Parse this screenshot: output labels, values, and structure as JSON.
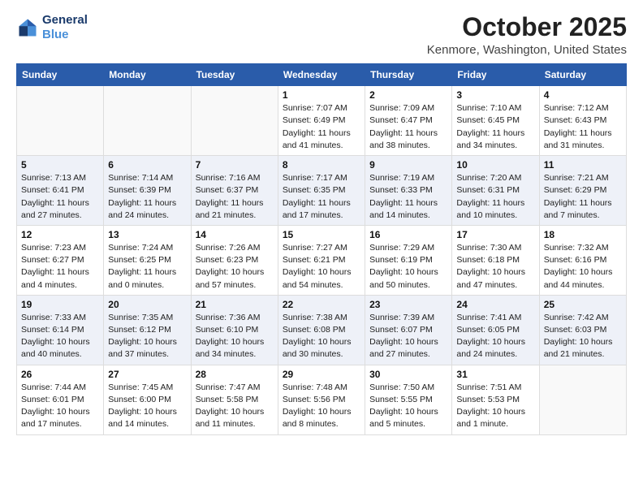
{
  "header": {
    "logo_line1": "General",
    "logo_line2": "Blue",
    "month": "October 2025",
    "location": "Kenmore, Washington, United States"
  },
  "weekdays": [
    "Sunday",
    "Monday",
    "Tuesday",
    "Wednesday",
    "Thursday",
    "Friday",
    "Saturday"
  ],
  "weeks": [
    [
      {
        "day": "",
        "sunrise": "",
        "sunset": "",
        "daylight": ""
      },
      {
        "day": "",
        "sunrise": "",
        "sunset": "",
        "daylight": ""
      },
      {
        "day": "",
        "sunrise": "",
        "sunset": "",
        "daylight": ""
      },
      {
        "day": "1",
        "sunrise": "Sunrise: 7:07 AM",
        "sunset": "Sunset: 6:49 PM",
        "daylight": "Daylight: 11 hours and 41 minutes."
      },
      {
        "day": "2",
        "sunrise": "Sunrise: 7:09 AM",
        "sunset": "Sunset: 6:47 PM",
        "daylight": "Daylight: 11 hours and 38 minutes."
      },
      {
        "day": "3",
        "sunrise": "Sunrise: 7:10 AM",
        "sunset": "Sunset: 6:45 PM",
        "daylight": "Daylight: 11 hours and 34 minutes."
      },
      {
        "day": "4",
        "sunrise": "Sunrise: 7:12 AM",
        "sunset": "Sunset: 6:43 PM",
        "daylight": "Daylight: 11 hours and 31 minutes."
      }
    ],
    [
      {
        "day": "5",
        "sunrise": "Sunrise: 7:13 AM",
        "sunset": "Sunset: 6:41 PM",
        "daylight": "Daylight: 11 hours and 27 minutes."
      },
      {
        "day": "6",
        "sunrise": "Sunrise: 7:14 AM",
        "sunset": "Sunset: 6:39 PM",
        "daylight": "Daylight: 11 hours and 24 minutes."
      },
      {
        "day": "7",
        "sunrise": "Sunrise: 7:16 AM",
        "sunset": "Sunset: 6:37 PM",
        "daylight": "Daylight: 11 hours and 21 minutes."
      },
      {
        "day": "8",
        "sunrise": "Sunrise: 7:17 AM",
        "sunset": "Sunset: 6:35 PM",
        "daylight": "Daylight: 11 hours and 17 minutes."
      },
      {
        "day": "9",
        "sunrise": "Sunrise: 7:19 AM",
        "sunset": "Sunset: 6:33 PM",
        "daylight": "Daylight: 11 hours and 14 minutes."
      },
      {
        "day": "10",
        "sunrise": "Sunrise: 7:20 AM",
        "sunset": "Sunset: 6:31 PM",
        "daylight": "Daylight: 11 hours and 10 minutes."
      },
      {
        "day": "11",
        "sunrise": "Sunrise: 7:21 AM",
        "sunset": "Sunset: 6:29 PM",
        "daylight": "Daylight: 11 hours and 7 minutes."
      }
    ],
    [
      {
        "day": "12",
        "sunrise": "Sunrise: 7:23 AM",
        "sunset": "Sunset: 6:27 PM",
        "daylight": "Daylight: 11 hours and 4 minutes."
      },
      {
        "day": "13",
        "sunrise": "Sunrise: 7:24 AM",
        "sunset": "Sunset: 6:25 PM",
        "daylight": "Daylight: 11 hours and 0 minutes."
      },
      {
        "day": "14",
        "sunrise": "Sunrise: 7:26 AM",
        "sunset": "Sunset: 6:23 PM",
        "daylight": "Daylight: 10 hours and 57 minutes."
      },
      {
        "day": "15",
        "sunrise": "Sunrise: 7:27 AM",
        "sunset": "Sunset: 6:21 PM",
        "daylight": "Daylight: 10 hours and 54 minutes."
      },
      {
        "day": "16",
        "sunrise": "Sunrise: 7:29 AM",
        "sunset": "Sunset: 6:19 PM",
        "daylight": "Daylight: 10 hours and 50 minutes."
      },
      {
        "day": "17",
        "sunrise": "Sunrise: 7:30 AM",
        "sunset": "Sunset: 6:18 PM",
        "daylight": "Daylight: 10 hours and 47 minutes."
      },
      {
        "day": "18",
        "sunrise": "Sunrise: 7:32 AM",
        "sunset": "Sunset: 6:16 PM",
        "daylight": "Daylight: 10 hours and 44 minutes."
      }
    ],
    [
      {
        "day": "19",
        "sunrise": "Sunrise: 7:33 AM",
        "sunset": "Sunset: 6:14 PM",
        "daylight": "Daylight: 10 hours and 40 minutes."
      },
      {
        "day": "20",
        "sunrise": "Sunrise: 7:35 AM",
        "sunset": "Sunset: 6:12 PM",
        "daylight": "Daylight: 10 hours and 37 minutes."
      },
      {
        "day": "21",
        "sunrise": "Sunrise: 7:36 AM",
        "sunset": "Sunset: 6:10 PM",
        "daylight": "Daylight: 10 hours and 34 minutes."
      },
      {
        "day": "22",
        "sunrise": "Sunrise: 7:38 AM",
        "sunset": "Sunset: 6:08 PM",
        "daylight": "Daylight: 10 hours and 30 minutes."
      },
      {
        "day": "23",
        "sunrise": "Sunrise: 7:39 AM",
        "sunset": "Sunset: 6:07 PM",
        "daylight": "Daylight: 10 hours and 27 minutes."
      },
      {
        "day": "24",
        "sunrise": "Sunrise: 7:41 AM",
        "sunset": "Sunset: 6:05 PM",
        "daylight": "Daylight: 10 hours and 24 minutes."
      },
      {
        "day": "25",
        "sunrise": "Sunrise: 7:42 AM",
        "sunset": "Sunset: 6:03 PM",
        "daylight": "Daylight: 10 hours and 21 minutes."
      }
    ],
    [
      {
        "day": "26",
        "sunrise": "Sunrise: 7:44 AM",
        "sunset": "Sunset: 6:01 PM",
        "daylight": "Daylight: 10 hours and 17 minutes."
      },
      {
        "day": "27",
        "sunrise": "Sunrise: 7:45 AM",
        "sunset": "Sunset: 6:00 PM",
        "daylight": "Daylight: 10 hours and 14 minutes."
      },
      {
        "day": "28",
        "sunrise": "Sunrise: 7:47 AM",
        "sunset": "Sunset: 5:58 PM",
        "daylight": "Daylight: 10 hours and 11 minutes."
      },
      {
        "day": "29",
        "sunrise": "Sunrise: 7:48 AM",
        "sunset": "Sunset: 5:56 PM",
        "daylight": "Daylight: 10 hours and 8 minutes."
      },
      {
        "day": "30",
        "sunrise": "Sunrise: 7:50 AM",
        "sunset": "Sunset: 5:55 PM",
        "daylight": "Daylight: 10 hours and 5 minutes."
      },
      {
        "day": "31",
        "sunrise": "Sunrise: 7:51 AM",
        "sunset": "Sunset: 5:53 PM",
        "daylight": "Daylight: 10 hours and 1 minute."
      },
      {
        "day": "",
        "sunrise": "",
        "sunset": "",
        "daylight": ""
      }
    ]
  ]
}
